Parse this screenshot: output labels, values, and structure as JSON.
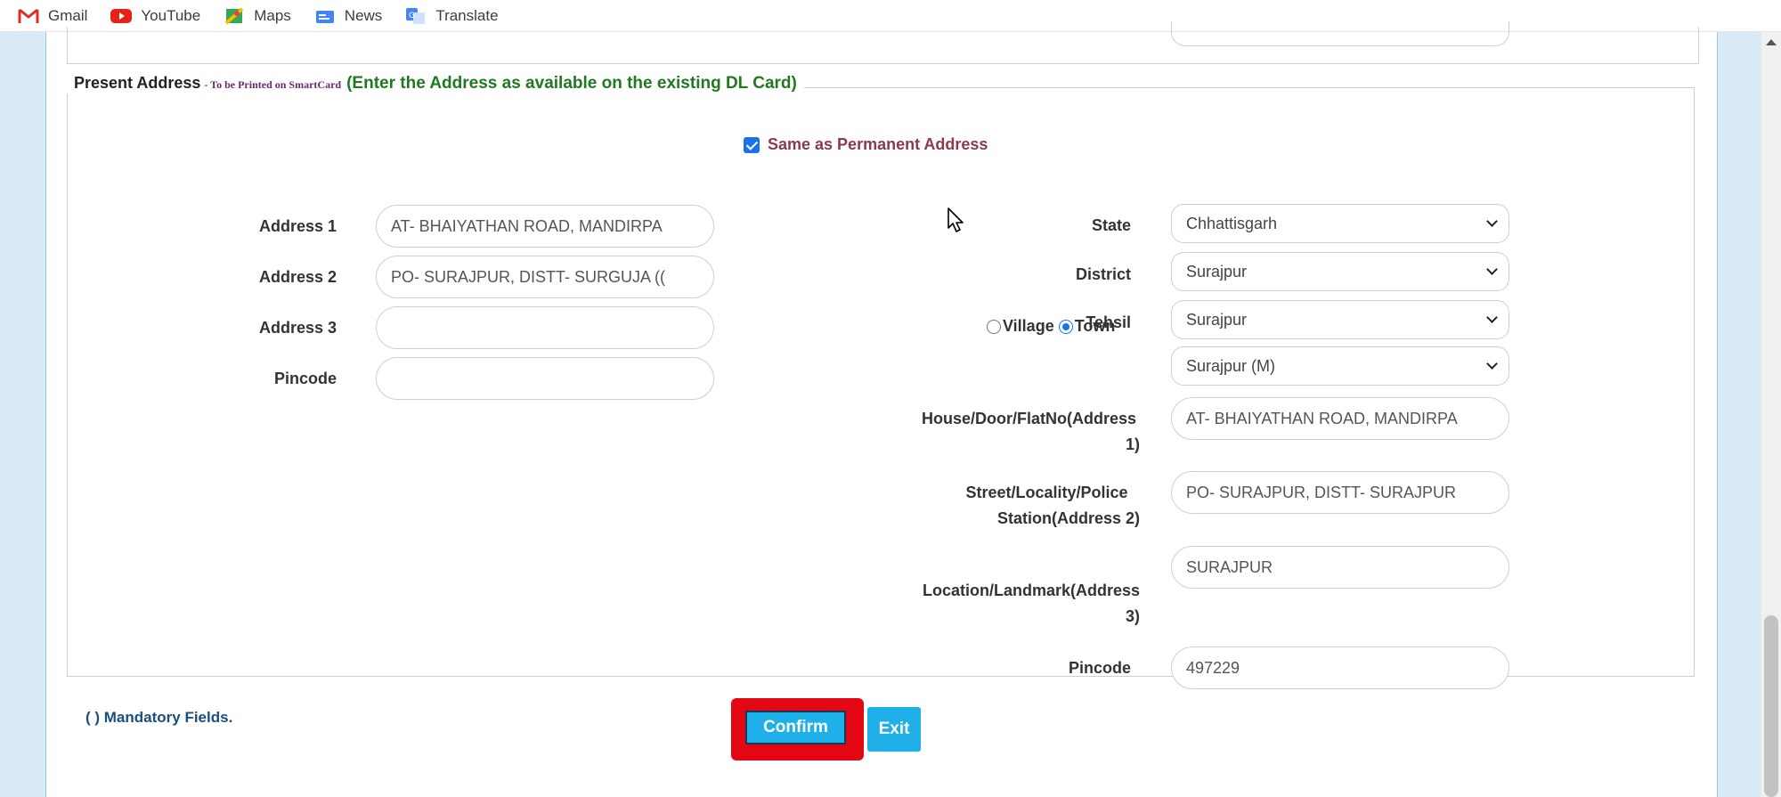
{
  "bookmarks": [
    {
      "label": "Gmail",
      "icon": "gmail-icon"
    },
    {
      "label": "YouTube",
      "icon": "youtube-icon"
    },
    {
      "label": "Maps",
      "icon": "maps-icon"
    },
    {
      "label": "News",
      "icon": "news-icon"
    },
    {
      "label": "Translate",
      "icon": "translate-icon"
    }
  ],
  "section": {
    "title": "Present Address",
    "subtitle": "- To be Printed on SmartCard",
    "note": "(Enter the Address as available on the existing DL Card)"
  },
  "same_as_permanent": {
    "label": "Same as Permanent Address",
    "checked": true
  },
  "left_form": {
    "address1": {
      "label": "Address 1",
      "value": "AT- BHAIYATHAN ROAD, MANDIRPA"
    },
    "address2": {
      "label": "Address 2",
      "value": "PO- SURAJPUR, DISTT- SURGUJA (("
    },
    "address3": {
      "label": "Address 3",
      "value": ""
    },
    "pincode": {
      "label": "Pincode",
      "value": ""
    }
  },
  "right_form": {
    "state": {
      "label": "State",
      "value": "Chhattisgarh"
    },
    "district": {
      "label": "District",
      "value": "Surajpur"
    },
    "tehsil": {
      "label": "Tehsil",
      "value": "Surajpur"
    },
    "village_label": "Village",
    "town_label": "Town",
    "selected_type": "Town",
    "town": {
      "value": "Surajpur (M)"
    },
    "house": {
      "label_line1": "House/Door/FlatNo(Address",
      "label_line2": "1)",
      "value": "AT- BHAIYATHAN ROAD, MANDIRPA"
    },
    "street": {
      "label_line1": "Street/Locality/Police",
      "label_line2": "Station(Address 2)",
      "value": "PO- SURAJPUR, DISTT- SURAJPUR"
    },
    "location": {
      "label_line1": "Location/Landmark(Address",
      "label_line2": "3)",
      "value": "SURAJPUR"
    },
    "pincode": {
      "label": "Pincode",
      "value": "497229"
    }
  },
  "footer": {
    "mandatory_note": "( ) Mandatory Fields.",
    "confirm_label": "Confirm",
    "exit_label": "Exit"
  },
  "colors": {
    "accent_button": "#1fb0ea",
    "highlight_box": "#e30613",
    "note_green": "#1f7a1f",
    "checkbox_blue": "#1a73e8"
  }
}
